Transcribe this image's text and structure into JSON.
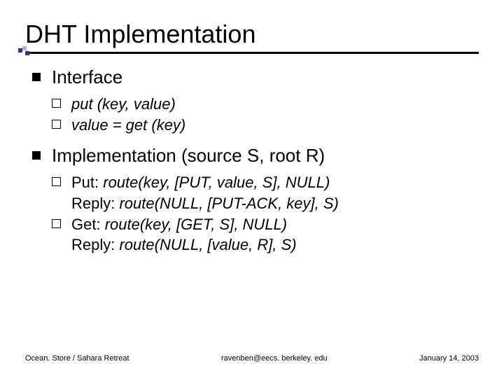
{
  "title": "DHT Implementation",
  "sections": [
    {
      "heading": "Interface",
      "items": [
        {
          "text1_i": "put",
          "text2": " (key, value)"
        },
        {
          "text1_i": "value",
          "text2": " = get (key)"
        }
      ]
    },
    {
      "heading": "Implementation (source S, root R)",
      "items": [
        {
          "label": "Put: ",
          "code": "route(key, [PUT, value, S], NULL)",
          "reply_label": "Reply: ",
          "reply_code": "route(NULL, [PUT-ACK, key], S)"
        },
        {
          "label": "Get: ",
          "code": "route(key, [GET, S], NULL)",
          "reply_label": "Reply: ",
          "reply_code": "route(NULL, [value, R], S)"
        }
      ]
    }
  ],
  "footer": {
    "left": "Ocean. Store / Sahara Retreat",
    "center": "ravenben@eecs. berkeley. edu",
    "right": "January 14, 2003"
  }
}
